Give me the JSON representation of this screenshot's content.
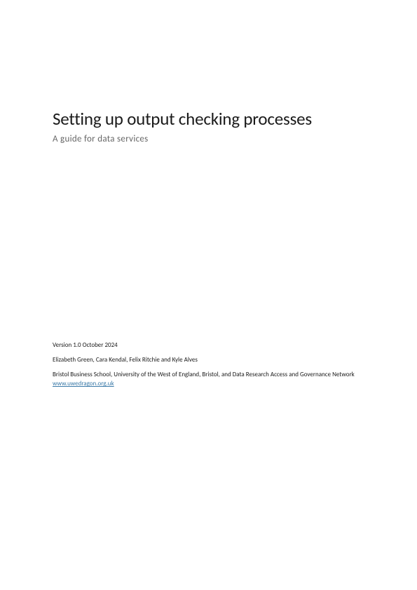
{
  "title": "Setting up output checking processes",
  "subtitle": "A guide for data services",
  "version_line": "Version 1.0  October 2024",
  "authors_line": "Elizabeth Green, Cara Kendal, Felix Ritchie and Kyle Alves",
  "affiliation_prefix": "Bristol Business School, University of the West of England, Bristol, and Data Research Access and Governance Network ",
  "link_text": "www.uwedragon.org.uk"
}
